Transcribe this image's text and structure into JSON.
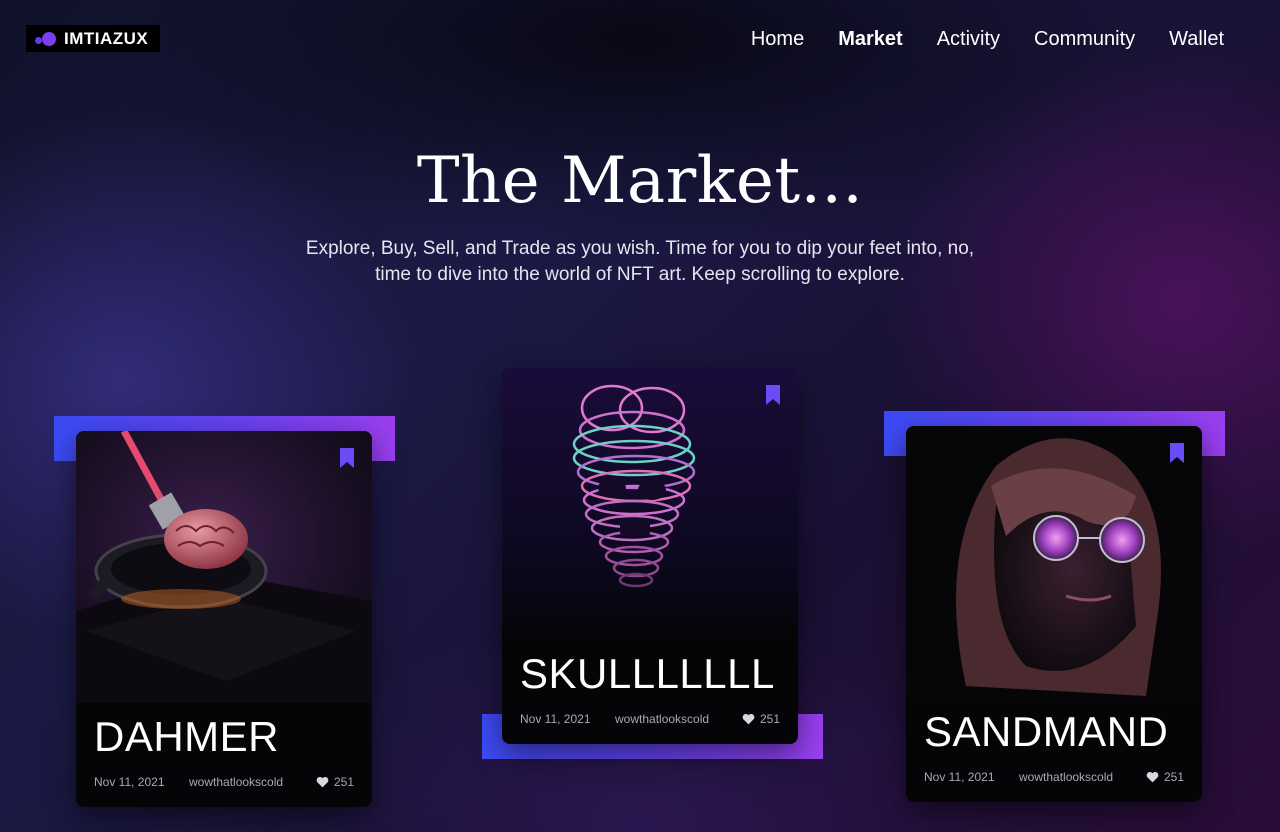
{
  "brand": {
    "name": "IMTIAZUX"
  },
  "nav": {
    "items": [
      {
        "label": "Home"
      },
      {
        "label": "Market"
      },
      {
        "label": "Activity"
      },
      {
        "label": "Community"
      },
      {
        "label": "Wallet"
      }
    ],
    "active": "Market"
  },
  "hero": {
    "title": "The Market...",
    "subtitle": "Explore, Buy, Sell, and Trade as you wish. Time for you to dip your feet into, no, time to dive into the world of NFT art. Keep scrolling to explore."
  },
  "cards": [
    {
      "title": "DAHMER",
      "date": "Nov 11, 2021",
      "user": "wowthatlookscold",
      "likes": "251",
      "image_icon": "brain-in-pan-icon"
    },
    {
      "title": "SKULLLLLLL",
      "date": "Nov 11, 2021",
      "user": "wowthatlookscold",
      "likes": "251",
      "image_icon": "skull-icon"
    },
    {
      "title": "SANDMAND",
      "date": "Nov 11, 2021",
      "user": "wowthatlookscold",
      "likes": "251",
      "image_icon": "face-with-glasses-icon"
    }
  ],
  "colors": {
    "accent": "#7b3ff2",
    "gradient_start": "#3b4bf5",
    "gradient_end": "#9b3ff0",
    "card_bg": "#050507"
  }
}
